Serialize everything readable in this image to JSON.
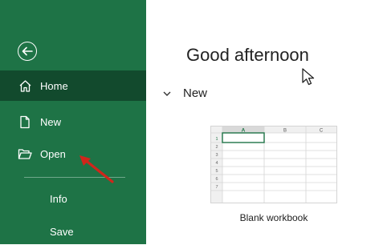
{
  "sidebar": {
    "items": [
      {
        "label": "Home",
        "icon": "home-icon",
        "active": true
      },
      {
        "label": "New",
        "icon": "new-document-icon",
        "active": false
      },
      {
        "label": "Open",
        "icon": "folder-open-icon",
        "active": false
      }
    ],
    "footer_items": [
      {
        "label": "Info"
      },
      {
        "label": "Save"
      }
    ]
  },
  "main": {
    "greeting": "Good afternoon",
    "section_title": "New",
    "template": {
      "label": "Blank workbook",
      "columns": [
        "A",
        "B",
        "C"
      ],
      "rows": [
        "1",
        "2",
        "3",
        "4",
        "5",
        "6",
        "7"
      ]
    }
  },
  "colors": {
    "sidebar_bg": "#1e7346",
    "active_item_bg": "#124a2d",
    "annotation_arrow": "#d0261b"
  }
}
